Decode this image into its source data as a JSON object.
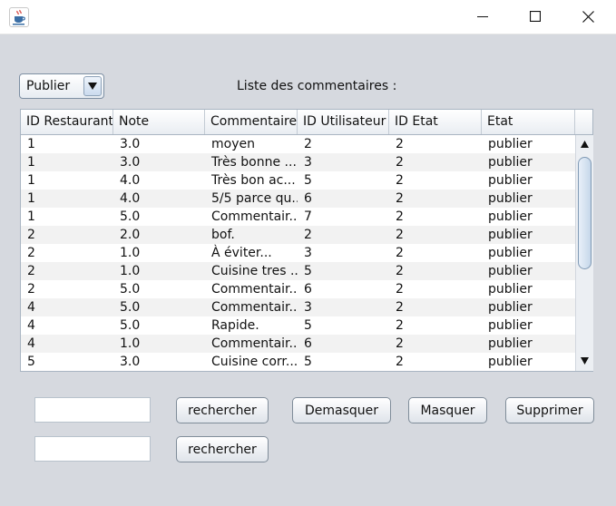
{
  "window": {
    "icon": "java-cup-icon",
    "controls": [
      "minimize-icon",
      "maximize-icon",
      "close-icon"
    ]
  },
  "filter": {
    "selected": "Publier"
  },
  "list_title": "Liste des commentaires :",
  "table": {
    "columns": [
      "ID Restaurant",
      "Note",
      "Commentaire",
      "ID Utilisateur",
      "ID Etat",
      "Etat"
    ],
    "rows": [
      [
        "1",
        "3.0",
        "moyen",
        "2",
        "2",
        "publier"
      ],
      [
        "1",
        "3.0",
        "Très bonne ...",
        "3",
        "2",
        "publier"
      ],
      [
        "1",
        "4.0",
        "Très bon ac...",
        "5",
        "2",
        "publier"
      ],
      [
        "1",
        "4.0",
        "5/5 parce qu...",
        "6",
        "2",
        "publier"
      ],
      [
        "1",
        "5.0",
        "Commentair...",
        "7",
        "2",
        "publier"
      ],
      [
        "2",
        "2.0",
        "bof.",
        "2",
        "2",
        "publier"
      ],
      [
        "2",
        "1.0",
        "À éviter...",
        "3",
        "2",
        "publier"
      ],
      [
        "2",
        "1.0",
        "Cuisine tres ...",
        "5",
        "2",
        "publier"
      ],
      [
        "2",
        "5.0",
        "Commentair...",
        "6",
        "2",
        "publier"
      ],
      [
        "4",
        "5.0",
        "Commentair...",
        "3",
        "2",
        "publier"
      ],
      [
        "4",
        "5.0",
        "Rapide.",
        "5",
        "2",
        "publier"
      ],
      [
        "4",
        "1.0",
        "Commentair...",
        "6",
        "2",
        "publier"
      ],
      [
        "5",
        "3.0",
        "Cuisine corr...",
        "5",
        "2",
        "publier"
      ]
    ]
  },
  "search1": {
    "value": "",
    "button": "rechercher"
  },
  "search2": {
    "value": "",
    "button": "rechercher"
  },
  "actions": {
    "demasquer": "Demasquer",
    "masquer": "Masquer",
    "supprimer": "Supprimer"
  }
}
